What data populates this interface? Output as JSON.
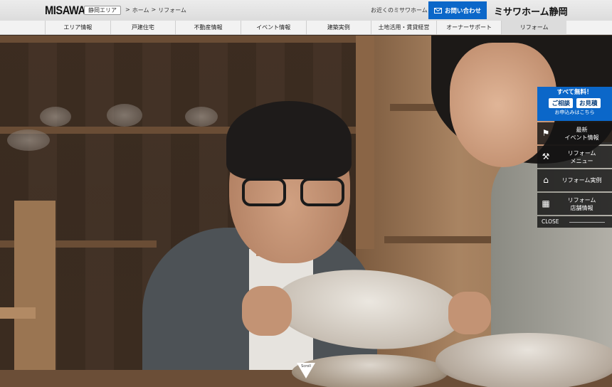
{
  "header": {
    "logo": "MISAWA",
    "area_badge": "静岡エリア",
    "breadcrumb": [
      ">",
      "ホーム",
      ">",
      "リフォーム"
    ],
    "nearby_link": "お近くのミサワホーム",
    "contact_label": "お問い合わせ",
    "brand": "ミサワホーム静岡"
  },
  "nav": {
    "items": [
      {
        "label": "エリア情報"
      },
      {
        "label": "戸建住宅"
      },
      {
        "label": "不動産情報"
      },
      {
        "label": "イベント情報"
      },
      {
        "label": "建築実例"
      },
      {
        "label": "土地活用・賃貸経営"
      },
      {
        "label": "オーナーサポート"
      },
      {
        "label": "リフォーム",
        "active": true
      }
    ]
  },
  "side": {
    "free_title": "すべて無料！",
    "pill_1": "ご相談",
    "pill_2": "お見積",
    "free_sub": "お申込みはこちら",
    "items": [
      {
        "icon": "flag-icon",
        "label_1": "最新",
        "label_2": "イベント情報"
      },
      {
        "icon": "tools-icon",
        "label_1": "リフォーム",
        "label_2": "メニュー"
      },
      {
        "icon": "house-icon",
        "label_1": "リフォーム実例",
        "label_2": ""
      },
      {
        "icon": "store-icon",
        "label_1": "リフォーム",
        "label_2": "店舗情報"
      }
    ],
    "close_label": "CLOSE"
  },
  "scroll_label": "Scroll",
  "colors": {
    "accent": "#0b67c9"
  }
}
